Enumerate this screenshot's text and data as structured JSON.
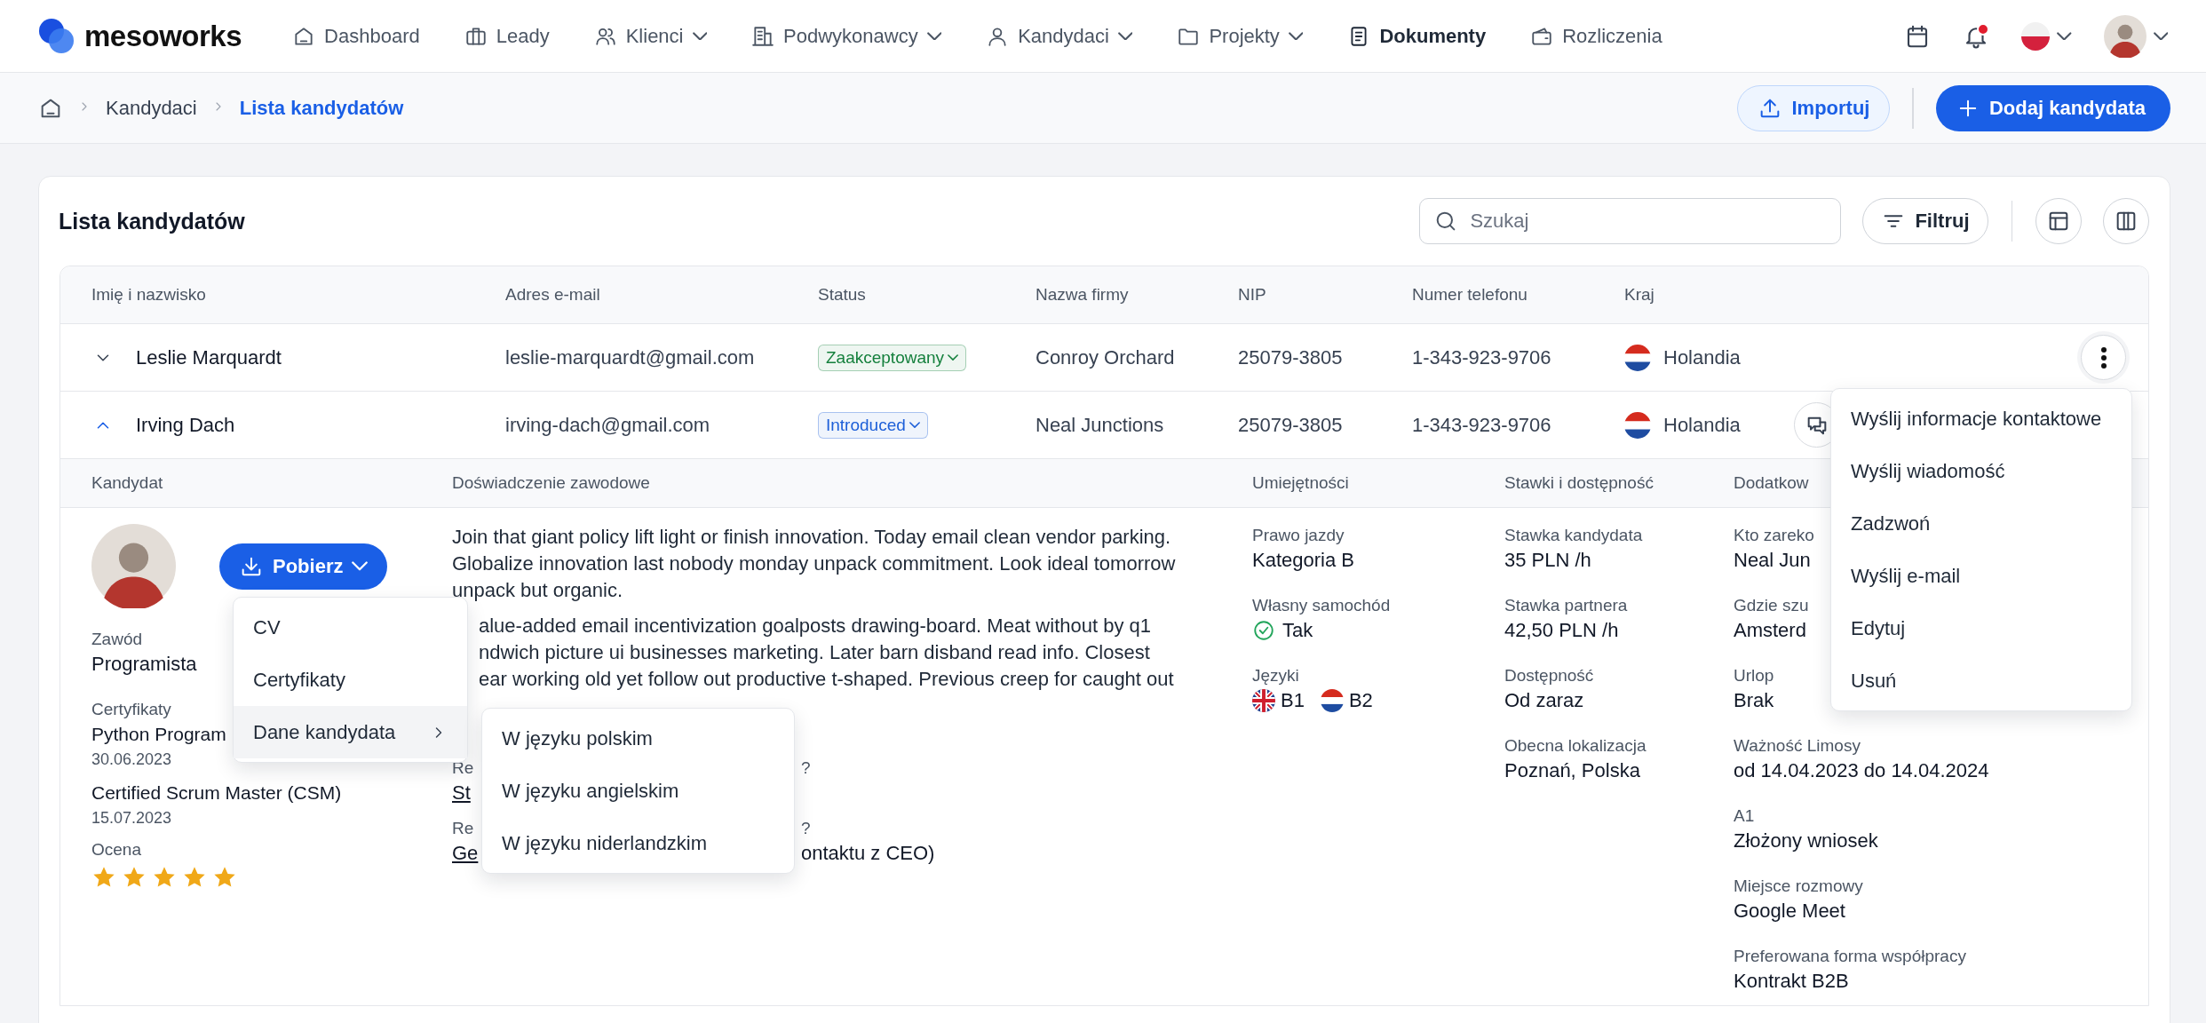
{
  "nav": {
    "logo": "mesoworks",
    "items": [
      {
        "label": "Dashboard",
        "kind": "home",
        "dropdown": false,
        "selected": false
      },
      {
        "label": "Leady",
        "kind": "briefcase",
        "dropdown": false,
        "selected": false
      },
      {
        "label": "Klienci",
        "kind": "users",
        "dropdown": true,
        "selected": false
      },
      {
        "label": "Podwykonawcy",
        "kind": "building",
        "dropdown": true,
        "selected": false
      },
      {
        "label": "Kandydaci",
        "kind": "user",
        "dropdown": true,
        "selected": false
      },
      {
        "label": "Projekty",
        "kind": "folder",
        "dropdown": true,
        "selected": false
      },
      {
        "label": "Dokumenty",
        "kind": "document",
        "dropdown": false,
        "selected": true
      },
      {
        "label": "Rozliczenia",
        "kind": "wallet",
        "dropdown": false,
        "selected": false
      }
    ],
    "notifications_unread": true,
    "language": {
      "kind": "pl"
    }
  },
  "breadcrumb": [
    {
      "label": "Kandydaci",
      "selected": false
    },
    {
      "label": "Lista kandydatów",
      "selected": true
    }
  ],
  "page_actions": [
    {
      "label": "Importuj",
      "kind": "import"
    },
    {
      "label": "Dodaj kandydata",
      "kind": "add"
    }
  ],
  "card": {
    "title": "Lista kandydatów",
    "search": {
      "placeholder": "Szukaj"
    },
    "filter_button": "Filtruj"
  },
  "table": {
    "columns": [
      "Imię i nazwisko",
      "Adres e-mail",
      "Status",
      "Nazwa firmy",
      "NIP",
      "Numer telefonu",
      "Kraj"
    ],
    "rows": [
      {
        "name": "Leslie Marquardt",
        "email": "leslie-marquardt@gmail.com",
        "status": {
          "label": "Zaakceptowany",
          "color": "#15803d"
        },
        "company": "Conroy Orchard",
        "nip": "25079-3805",
        "phone": "1-343-923-9706",
        "country": {
          "label": "Holandia",
          "kind": "nl"
        },
        "expanded": false,
        "action": {
          "kind": "more"
        }
      },
      {
        "name": "Irving Dach",
        "email": "irving-dach@gmail.com",
        "status": {
          "label": "Introduced",
          "color": "#1d5fd8"
        },
        "company": "Neal Junctions",
        "nip": "25079-3805",
        "phone": "1-343-923-9706",
        "country": {
          "label": "Holandia",
          "kind": "nl"
        },
        "expanded": true,
        "action": {
          "kind": "chat"
        }
      }
    ]
  },
  "detail": {
    "columns": [
      "Kandydat",
      "Doświadczenie zawodowe",
      "Umiejętności",
      "Stawki i dostępność",
      "Dodatkow"
    ],
    "candidate": {
      "download_button": "Pobierz",
      "fields": [
        {
          "label": "Zawód",
          "value": "Programista"
        }
      ],
      "certificates_label": "Certyfikaty",
      "certificates": [
        {
          "name": "Python Program",
          "date": "30.06.2023"
        },
        {
          "name": "Certified Scrum Master (CSM)",
          "date": "15.07.2023"
        }
      ],
      "rating_label": "Ocena",
      "stars": 5
    },
    "experience": {
      "paragraphs": [
        [
          "Join that giant policy lift light or finish innovation. Today email clean vendor parking.",
          "Globalize innovation last nobody monday unpack commitment. Look ideal tomorrow",
          "unpack but organic."
        ],
        [
          "alue-added email incentivization goalposts drawing-board. Meat without by q1",
          "ndwich picture ui businesses marketing. Later barn disband read info. Closest",
          "ear working old yet follow out productive t-shaped. Previous creep for caught out"
        ]
      ],
      "fields": [
        {
          "label_start": "Re",
          "label_end": "?",
          "value_start": "St"
        },
        {
          "label_start": "Re",
          "label_end": "?",
          "value_start": "Ge",
          "value_end": "ontaktu z CEO)"
        }
      ]
    },
    "skills": [
      {
        "label": "Prawo jazdy",
        "kind": "text",
        "value": "Kategoria B"
      },
      {
        "label": "Własny samochód",
        "kind": "check",
        "value": "Tak"
      },
      {
        "label": "Języki",
        "kind": "languages",
        "languages": [
          {
            "kind": "uk",
            "level": "B1"
          },
          {
            "kind": "nl",
            "level": "B2"
          }
        ]
      }
    ],
    "rates": [
      {
        "label": "Stawka kandydata",
        "value": "35 PLN /h"
      },
      {
        "label": "Stawka partnera",
        "value": "42,50 PLN /h"
      },
      {
        "label": "Dostępność",
        "value": "Od zaraz"
      },
      {
        "label": "Obecna lokalizacja",
        "value": "Poznań, Polska"
      }
    ],
    "additional": [
      {
        "label": "Kto zareko",
        "value": "Neal Jun"
      },
      {
        "label": "Gdzie szu",
        "value": "Amsterd"
      },
      {
        "label": "Urlop",
        "value": "Brak"
      },
      {
        "label": "Ważność Limosy",
        "value": "od 14.04.2023 do 14.04.2024"
      },
      {
        "label": "A1",
        "value": "Złożony wniosek"
      },
      {
        "label": "Miejsce rozmowy",
        "value": "Google Meet"
      },
      {
        "label": "Preferowana forma współpracy",
        "value": "Kontrakt B2B"
      }
    ]
  },
  "row_menu": [
    "Wyślij informacje kontaktowe",
    "Wyślij wiadomość",
    "Zadzwoń",
    "Wyślij e-mail",
    "Edytuj",
    "Usuń"
  ],
  "download_menu": [
    {
      "label": "CV",
      "selected": false,
      "submenu": false
    },
    {
      "label": "Certyfikaty",
      "selected": false,
      "submenu": false
    },
    {
      "label": "Dane kandydata",
      "selected": true,
      "submenu": true
    }
  ],
  "download_submenu": [
    "W języku polskim",
    "W języku angielskim",
    "W języku niderlandzkim"
  ]
}
